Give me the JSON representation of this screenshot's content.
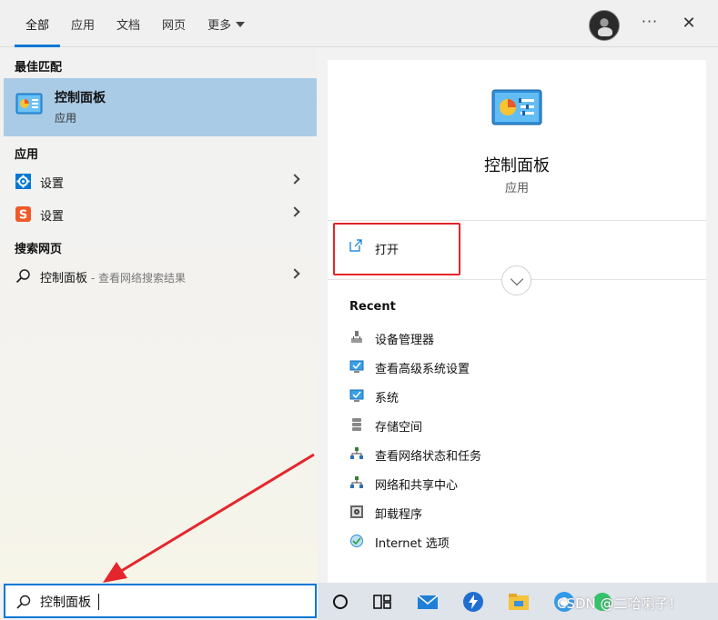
{
  "tabs": [
    {
      "label": "全部",
      "active": true
    },
    {
      "label": "应用"
    },
    {
      "label": "文档"
    },
    {
      "label": "网页"
    },
    {
      "label": "更多"
    }
  ],
  "topbar": {
    "more_label": "···",
    "close_label": "✕"
  },
  "left": {
    "best_match_header": "最佳匹配",
    "best_match": {
      "title": "控制面板",
      "subtitle": "应用",
      "icon": "control-panel-icon"
    },
    "apps_header": "应用",
    "apps": [
      {
        "label": "设置",
        "icon": "gear-icon",
        "icon_color": "#0078d4"
      },
      {
        "label": "设置",
        "icon": "sogou-icon",
        "icon_color": "#f05a28"
      }
    ],
    "web_header": "搜索网页",
    "web_result": {
      "label": "控制面板",
      "hint": " - 查看网络搜索结果",
      "icon": "search-icon"
    }
  },
  "right": {
    "app_name": "控制面板",
    "app_type": "应用",
    "open_label": "打开",
    "recent_header": "Recent",
    "recent": [
      {
        "label": "设备管理器",
        "icon": "device-manager-icon"
      },
      {
        "label": "查看高级系统设置",
        "icon": "monitor-check-icon"
      },
      {
        "label": "系统",
        "icon": "monitor-icon"
      },
      {
        "label": "存储空间",
        "icon": "storage-icon"
      },
      {
        "label": "查看网络状态和任务",
        "icon": "network-icon"
      },
      {
        "label": "网络和共享中心",
        "icon": "network-icon"
      },
      {
        "label": "卸载程序",
        "icon": "uninstall-icon"
      },
      {
        "label": "Internet 选项",
        "icon": "internet-options-icon"
      }
    ]
  },
  "search": {
    "value": "控制面板"
  },
  "taskbar": {
    "icons": [
      "cortana-icon",
      "task-view-icon",
      "mail-icon",
      "bolt-app-icon",
      "file-explorer-icon",
      "chrome-icon",
      "green-app-icon"
    ]
  },
  "watermark": "CSDN @二哈喇子！",
  "colors": {
    "accent": "#0078d4",
    "selection": "#a9cbe6",
    "highlight_box": "#e4262c",
    "arrow": "#e4262c"
  }
}
